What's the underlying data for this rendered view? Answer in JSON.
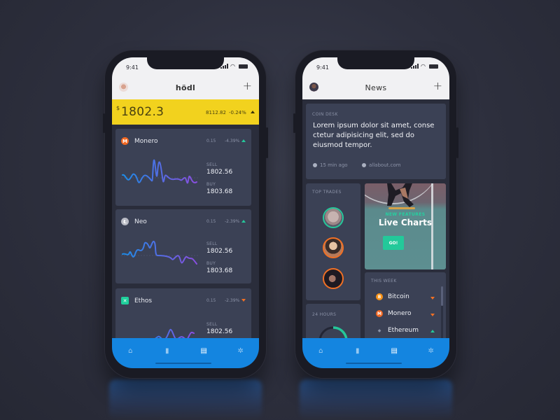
{
  "left_phone": {
    "status": {
      "time": "9:41"
    },
    "appbar": {
      "title": "hödl",
      "add_icon": "+"
    },
    "price": {
      "currency": "$",
      "value": "1802.3",
      "volume": "8112.82",
      "change": "-0.24%",
      "trend": "up"
    },
    "coins": [
      {
        "name": "Monero",
        "icon": "monero",
        "icon_glyph": "M",
        "color": "#f26822",
        "qty": "0.15",
        "change": "-4.39%",
        "trend": "up",
        "sell_label": "SELL",
        "sell": "1802.56",
        "buy_label": "BUY",
        "buy": "1803.68"
      },
      {
        "name": "Neo",
        "icon": "litecoin",
        "icon_glyph": "Ł",
        "color": "#b8bac4",
        "qty": "0.15",
        "change": "-2.39%",
        "trend": "up",
        "sell_label": "SELL",
        "sell": "1802.56",
        "buy_label": "BUY",
        "buy": "1803.68"
      },
      {
        "name": "Ethos",
        "icon": "ethos",
        "icon_glyph": "✕",
        "color": "#1fcf9c",
        "qty": "0.15",
        "change": "-2.39%",
        "trend": "down",
        "sell_label": "SELL",
        "sell": "1802.56"
      }
    ],
    "tabs": [
      {
        "name": "home",
        "glyph": "⌂",
        "active": false
      },
      {
        "name": "stats",
        "glyph": "▮",
        "active": false
      },
      {
        "name": "news",
        "glyph": "▤",
        "active": true
      },
      {
        "name": "settings",
        "glyph": "✲",
        "active": false
      }
    ]
  },
  "right_phone": {
    "status": {
      "time": "9:41"
    },
    "appbar": {
      "title": "News",
      "add_icon": "+"
    },
    "news": {
      "source": "COIN DESK",
      "headline": "Lorem ipsum dolor sit amet, conse ctetur adipisicing elit, sed do eiusmod tempor.",
      "time_ago": "15 min ago",
      "site": "allabout.com"
    },
    "top_trades": {
      "label": "TOP TRADES",
      "ring_colors": [
        "#25c79a",
        "#f07025",
        "#f07025"
      ]
    },
    "promo": {
      "subtitle": "NEW FEATURES",
      "title": "Live Charts",
      "button": "GO!"
    },
    "hours": {
      "label": "24 HOURS",
      "progress": 0.3
    },
    "this_week": {
      "label": "THIS WEEK",
      "items": [
        {
          "name": "Bitcoin",
          "glyph": "B",
          "color": "#f7931a",
          "trend": "down"
        },
        {
          "name": "Monero",
          "glyph": "M",
          "color": "#f26822",
          "trend": "down"
        },
        {
          "name": "Ethereum",
          "glyph": "◆",
          "color": "#3b4155",
          "trend": "up"
        }
      ]
    },
    "tabs": [
      {
        "name": "home",
        "glyph": "⌂",
        "active": false
      },
      {
        "name": "stats",
        "glyph": "▮",
        "active": false
      },
      {
        "name": "news",
        "glyph": "▤",
        "active": true
      },
      {
        "name": "settings",
        "glyph": "✲",
        "active": false
      }
    ]
  },
  "colors": {
    "accent_blue": "#1485e0",
    "accent_yellow": "#f2d21e",
    "up_green": "#25c79a",
    "down_orange": "#f07025",
    "card_bg": "#3b4155"
  }
}
